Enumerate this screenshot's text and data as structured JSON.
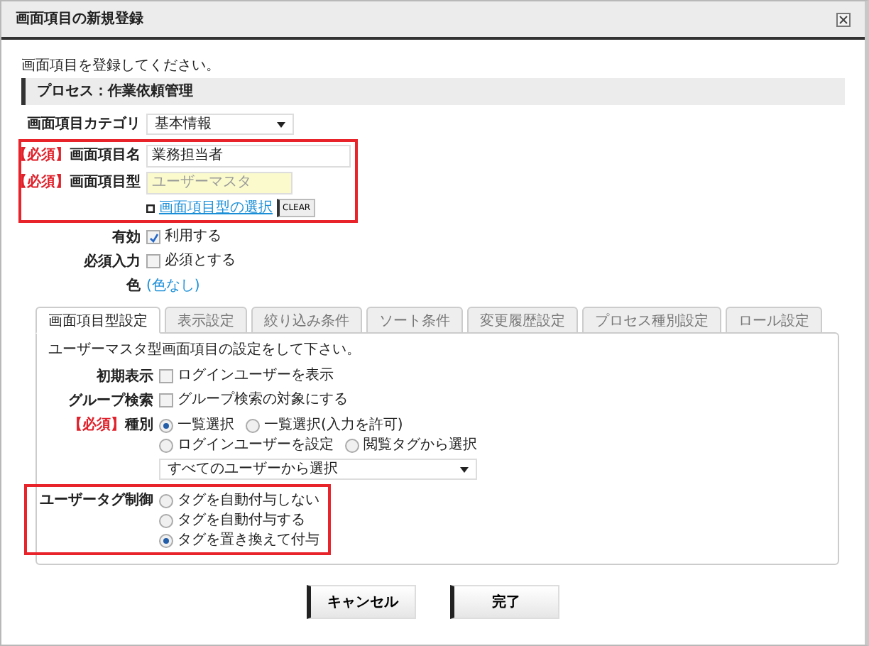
{
  "window": {
    "title": "画面項目の新規登録"
  },
  "intro": "画面項目を登録してください。",
  "section_header": "プロセス：作業依頼管理",
  "form_rows": [
    {
      "kind": "select",
      "label": "画面項目カテゴリ",
      "value": "基本情報",
      "highlighted": false
    },
    {
      "kind": "text",
      "required_tag": "【必須】",
      "label": "画面項目名",
      "value": "業務担当者",
      "highlighted": true
    },
    {
      "kind": "type",
      "required_tag": "【必須】",
      "label": "画面項目型",
      "placeholder": "ユーザーマスタ",
      "link": "画面項目型の選択",
      "clear": "CLEAR",
      "highlighted": true
    },
    {
      "kind": "checkbox",
      "label": "有効",
      "option": "利用する",
      "checked": true,
      "highlighted": false
    },
    {
      "kind": "checkbox",
      "label": "必須入力",
      "option": "必須とする",
      "checked": false,
      "highlighted": false
    },
    {
      "kind": "color",
      "label": "色",
      "value": "(色なし)",
      "highlighted": false
    }
  ],
  "tabs": [
    {
      "label": "画面項目型設定",
      "selected": true
    },
    {
      "label": "表示設定",
      "selected": false
    },
    {
      "label": "絞り込み条件",
      "selected": false
    },
    {
      "label": "ソート条件",
      "selected": false
    },
    {
      "label": "変更履歴設定",
      "selected": false
    },
    {
      "label": "プロセス種別設定",
      "selected": false
    },
    {
      "label": "ロール設定",
      "selected": false
    }
  ],
  "panel": {
    "description": "ユーザーマスタ型画面項目の設定をして下さい。",
    "rows": [
      {
        "kind": "checkbox",
        "label": "初期表示",
        "option": "ログインユーザーを表示",
        "checked": false,
        "highlighted": false
      },
      {
        "kind": "checkbox",
        "label": "グループ検索",
        "option": "グループ検索の対象にする",
        "checked": false,
        "highlighted": false
      },
      {
        "kind": "radio",
        "required_tag": "【必須】",
        "label": "種別",
        "highlighted": false,
        "options": [
          {
            "label": "一覧選択",
            "selected": true
          },
          {
            "label": "一覧選択(入力を許可)",
            "selected": false
          },
          {
            "label": "ログインユーザーを設定",
            "selected": false
          },
          {
            "label": "閲覧タグから選択",
            "selected": false
          }
        ]
      },
      {
        "kind": "select",
        "value": "すべてのユーザーから選択",
        "highlighted": false
      },
      {
        "kind": "radio_list",
        "label": "ユーザータグ制御",
        "highlighted": true,
        "options": [
          {
            "label": "タグを自動付与しない",
            "selected": false
          },
          {
            "label": "タグを自動付与する",
            "selected": false
          },
          {
            "label": "タグを置き換えて付与",
            "selected": true
          }
        ]
      }
    ]
  },
  "buttons": [
    "キャンセル",
    "完了"
  ]
}
